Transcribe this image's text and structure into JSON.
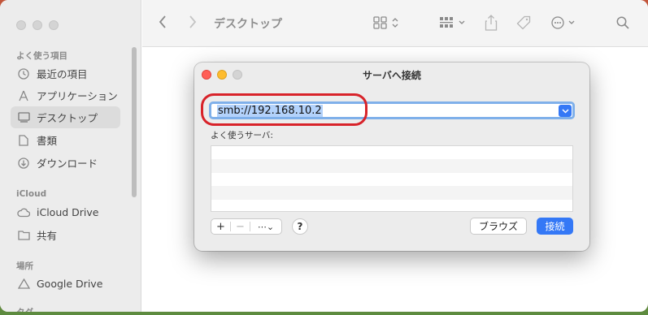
{
  "finder": {
    "title": "デスクトップ",
    "sidebar": {
      "favorites_header": "よく使う項目",
      "items": [
        {
          "label": "最近の項目",
          "icon": "clock-icon"
        },
        {
          "label": "アプリケーション",
          "icon": "apps-icon"
        },
        {
          "label": "デスクトップ",
          "icon": "desktop-icon",
          "selected": true
        },
        {
          "label": "書類",
          "icon": "document-icon"
        },
        {
          "label": "ダウンロード",
          "icon": "download-icon"
        }
      ],
      "icloud_header": "iCloud",
      "icloud_items": [
        {
          "label": "iCloud Drive",
          "icon": "cloud-icon"
        },
        {
          "label": "共有",
          "icon": "shared-folder-icon"
        }
      ],
      "locations_header": "場所",
      "location_items": [
        {
          "label": "Google Drive",
          "icon": "drive-icon"
        }
      ],
      "tags_header": "タグ"
    }
  },
  "dialog": {
    "title": "サーバへ接続",
    "address_value": "smb://192.168.10.2",
    "favorites_label": "よく使うサーバ:",
    "favorites_rows": 5,
    "add_label": "+",
    "remove_label": "−",
    "more_label": "⋯⌄",
    "help_label": "?",
    "browse_label": "ブラウズ",
    "connect_label": "接続"
  },
  "colors": {
    "accent": "#3478f6",
    "annotation_ring": "#d8232a",
    "close": "#ff5f57",
    "minimize": "#febc2e",
    "zoom_inactive": "#d4d4d4"
  }
}
